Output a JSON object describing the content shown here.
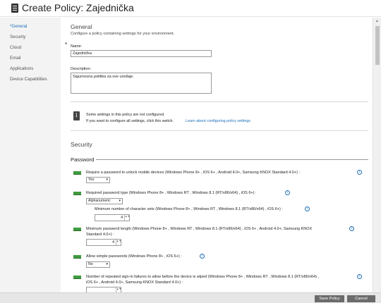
{
  "window": {
    "title": "Create Policy: Zajednička",
    "title_icon": "policy-document-icon"
  },
  "sidebar": {
    "items": [
      {
        "label": "*General",
        "active": true
      },
      {
        "label": "Security"
      },
      {
        "label": "Cloud"
      },
      {
        "label": "Email"
      },
      {
        "label": "Applications"
      },
      {
        "label": "Device Capabilities"
      }
    ]
  },
  "general": {
    "heading": "General",
    "subheading": "Configure a policy containing settings for your environment.",
    "required_mark": "*",
    "name_label": "Name:",
    "name_value": "Zajednička",
    "description_label": "Description:",
    "description_value": "Sigurnosna politika za sve uređaje."
  },
  "notice": {
    "icon": "info-icon",
    "line1": "Some settings in this policy are not configured.",
    "line2": "If you want to configure all settings, click this switch.",
    "link": "Learn about configuring policy settings"
  },
  "security": {
    "heading": "Security",
    "password_heading": "Password",
    "settings": [
      {
        "label": "Require a password to unlock mobile devices (Windows Phone 8+ , iOS 6+ , Android 4.0+, Samsung KNOX Standard 4.0+) :",
        "control": "Yes"
      },
      {
        "label": "Required password type (Windows Phone 8+ , Windows RT , Windows 8.1 (RT/x86/x64) , iOS 6+) :",
        "control": "Alphanumeric"
      },
      {
        "label": "Minimum number of character sets (Windows Phone 8+ , Windows RT , Windows 8.1 (RT/x86/x64) , iOS 6+) :",
        "control": "4"
      },
      {
        "label": "Minimum password length (Windows Phone 8+ , Windows RT , Windows 8.1 (RT/x86/x64) , iOS 6+ , Android 4.0+, Samsung KNOX",
        "label2": "Standard 4.0+) :",
        "control": "4"
      },
      {
        "label": "Allow simple passwords (Windows Phone 8+ , iOS 6+) :",
        "control": "No"
      },
      {
        "label": "Number of repeated sign-in failures to allow before the device is wiped (Windows Phone 8+ , Windows RT , Windows 8.1 (RT/x86/x64) ,",
        "label2": "iOS 6+ , Android 4.0+, Samsung KNOX Standard 4.0+) :"
      }
    ],
    "help_glyph": "i",
    "spin_glyph": "▲▼",
    "select_glyph": "▾"
  },
  "footer": {
    "save_label": "Save Policy",
    "cancel_label": "Cancel"
  },
  "scrollbar": {
    "up_glyph": "▲"
  },
  "colors": {
    "accent": "#1f6fb5",
    "toggle_on": "#3f9b3f",
    "button": "#6b6b6b"
  }
}
